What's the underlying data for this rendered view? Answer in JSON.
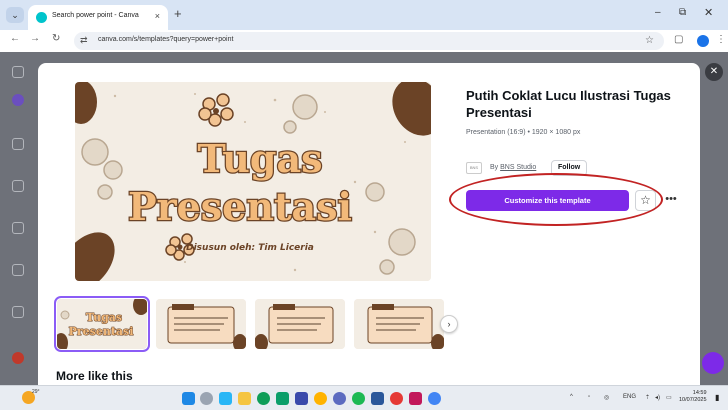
{
  "browser": {
    "tab_title": "Search power point - Canva",
    "url": "canva.com/s/templates?query=power+point",
    "tab_close_glyph": "×",
    "new_tab_glyph": "+",
    "minimize_glyph": "–",
    "maximize_glyph": "⧉",
    "close_glyph": "✕",
    "back_glyph": "←",
    "forward_glyph": "→",
    "reload_glyph": "↻",
    "site_info_glyph": "⇄",
    "bookmark_glyph": "☆",
    "menu_glyph": "⋮",
    "tab_menu_glyph": "⌄"
  },
  "template": {
    "title": "Putih Coklat Lucu Ilustrasi Tugas Presentasi",
    "meta": "Presentation (16:9) • 1920 × 1080 px",
    "by_prefix": "By",
    "author": "BNS Studio",
    "follow_label": "Follow",
    "customize_label": "Customize this template",
    "favorite_glyph": "☆",
    "more_glyph": "•••",
    "preview_heading_1": "Tugas",
    "preview_heading_2": "Presentasi",
    "preview_byline": "Disusun oleh: Tim Liceria",
    "thumb1_heading_1": "Tugas",
    "thumb1_heading_2": "Presentasi",
    "next_glyph": "›"
  },
  "page": {
    "more_like_this": "More like this",
    "overlay_close_glyph": "✕"
  },
  "taskbar": {
    "temperature": "29°",
    "lang": "ENG",
    "time": "14:59",
    "date": "10/07/2025",
    "up_glyph": "^",
    "wifi_glyph": "⇡",
    "volume_glyph": "◂)",
    "battery_glyph": "▭"
  },
  "colors": {
    "accent_purple": "#7d2ae8",
    "annotation_red": "#c22323",
    "preview_brown": "#6b4326",
    "preview_cream": "#f3ede4"
  }
}
